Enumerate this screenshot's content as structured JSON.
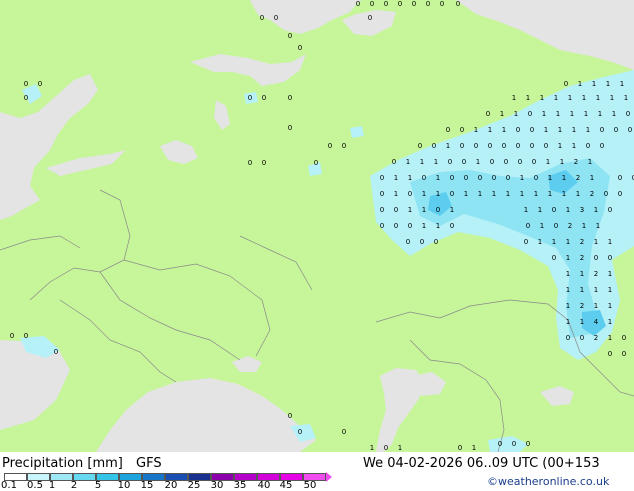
{
  "title": {
    "variable": "Precipitation [mm]",
    "model": "GFS",
    "datetime": "We 04-02-2026 06..09 UTC (00+153"
  },
  "credit": "©weatheronline.co.uk",
  "legend": {
    "labels": [
      "0.1",
      "0.5",
      "1",
      "2",
      "5",
      "10",
      "15",
      "20",
      "25",
      "30",
      "35",
      "40",
      "45",
      "50"
    ],
    "colors": [
      "#ffffff",
      "#c8f4fb",
      "#9ee8f6",
      "#66d9f0",
      "#33c4e8",
      "#1ea4dd",
      "#1876c8",
      "#1a4fb2",
      "#18308e",
      "#8b00aa",
      "#b400c8",
      "#d200d8",
      "#e600e6",
      "#f04cf0"
    ]
  },
  "colors": {
    "land": "#c6f59a",
    "sea": "#e4e4e4",
    "precip_light": "#b6f1f8",
    "precip_mid": "#8fe4f4",
    "precip_strong": "#5ccdef",
    "border": "#8a8a8a"
  },
  "values": [
    "0",
    "1",
    "2",
    "3",
    "4"
  ]
}
